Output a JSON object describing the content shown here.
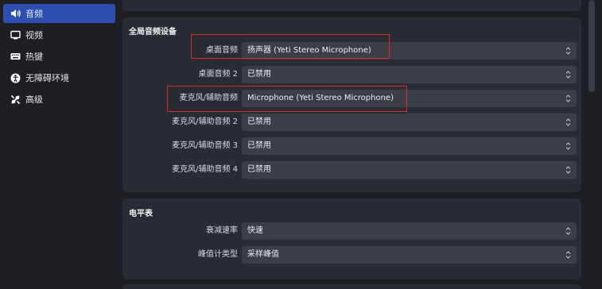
{
  "sidebar": {
    "items": [
      {
        "label": "音频",
        "icon": "speaker-icon",
        "active": true
      },
      {
        "label": "视频",
        "icon": "monitor-icon",
        "active": false
      },
      {
        "label": "热键",
        "icon": "keyboard-icon",
        "active": false
      },
      {
        "label": "无障碍环境",
        "icon": "accessibility-icon",
        "active": false
      },
      {
        "label": "高级",
        "icon": "wrench-icon",
        "active": false
      }
    ]
  },
  "global_audio": {
    "title": "全局音频设备",
    "rows": [
      {
        "label": "桌面音频",
        "value": "扬声器 (Yeti Stereo Microphone)"
      },
      {
        "label": "桌面音频 2",
        "value": "已禁用"
      },
      {
        "label": "麦克风/辅助音频",
        "value": "Microphone (Yeti Stereo Microphone)"
      },
      {
        "label": "麦克风/辅助音频 2",
        "value": "已禁用"
      },
      {
        "label": "麦克风/辅助音频 3",
        "value": "已禁用"
      },
      {
        "label": "麦克风/辅助音频 4",
        "value": "已禁用"
      }
    ]
  },
  "meters": {
    "title": "电平表",
    "rows": [
      {
        "label": "衰减速率",
        "value": "快速"
      },
      {
        "label": "峰值计类型",
        "value": "采样峰值"
      }
    ]
  },
  "colors": {
    "accent": "#2d4fb1",
    "highlight": "#d92b2b",
    "panel": "#2a2c33",
    "background": "#1e1f25"
  }
}
